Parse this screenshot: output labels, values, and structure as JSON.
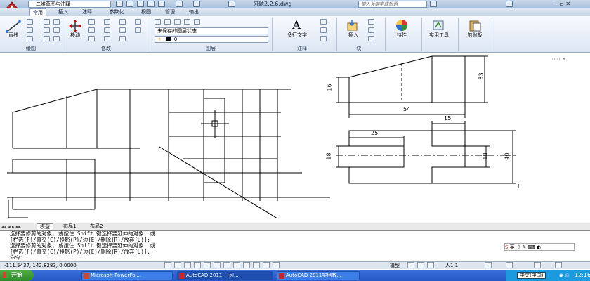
{
  "window": {
    "workspace": "二维草图与注释",
    "file_title": "习题2.2.6.dwg",
    "search_placeholder": "键入关键字或短语"
  },
  "ribbon": {
    "tabs": [
      "常用",
      "插入",
      "注释",
      "参数化",
      "视图",
      "管理",
      "输出"
    ],
    "active_tab": "常用",
    "tools": {
      "line": "直线",
      "move": "移动",
      "text": "多行文字",
      "insert": "插入",
      "properties": "特性",
      "utilities": "实用工具",
      "clipboard": "剪贴板"
    },
    "layer_state": "未保存的图层状态",
    "layer_name": "0",
    "panels": [
      "绘图",
      "修改",
      "图层",
      "注释",
      "块"
    ]
  },
  "drawing": {
    "dimensions": [
      "16",
      "33",
      "54",
      "15",
      "25",
      "18",
      "18",
      "40"
    ]
  },
  "layout_tabs": [
    "模型",
    "布局1",
    "布局2"
  ],
  "command_lines": [
    "选择要修剪的对象, 或按住 Shift 键选择要延伸的对象, 或",
    "[栏选(F)/窗交(C)/投影(P)/边(E)/删除(R)/放弃(U)]:",
    "选择要修剪的对象, 或按住 Shift 键选择要延伸的对象, 或",
    "[栏选(F)/窗交(C)/投影(P)/边(E)/删除(R)/放弃(U)]:",
    "命令:"
  ],
  "status": {
    "coords": "-111.5437, 142.8283, 0.0000",
    "space": "模型",
    "scale": "人1:1"
  },
  "taskbar": {
    "start": "开始",
    "items": [
      "Microsoft PowerPoi...",
      "AutoCAD 2011 - [习...",
      "AutoCAD 2011实例教..."
    ],
    "lang": "中文(中国)",
    "clock": "12:16"
  },
  "colors": {
    "accent": "#2557c6",
    "title_gradient_top": "#c8d8ea"
  }
}
